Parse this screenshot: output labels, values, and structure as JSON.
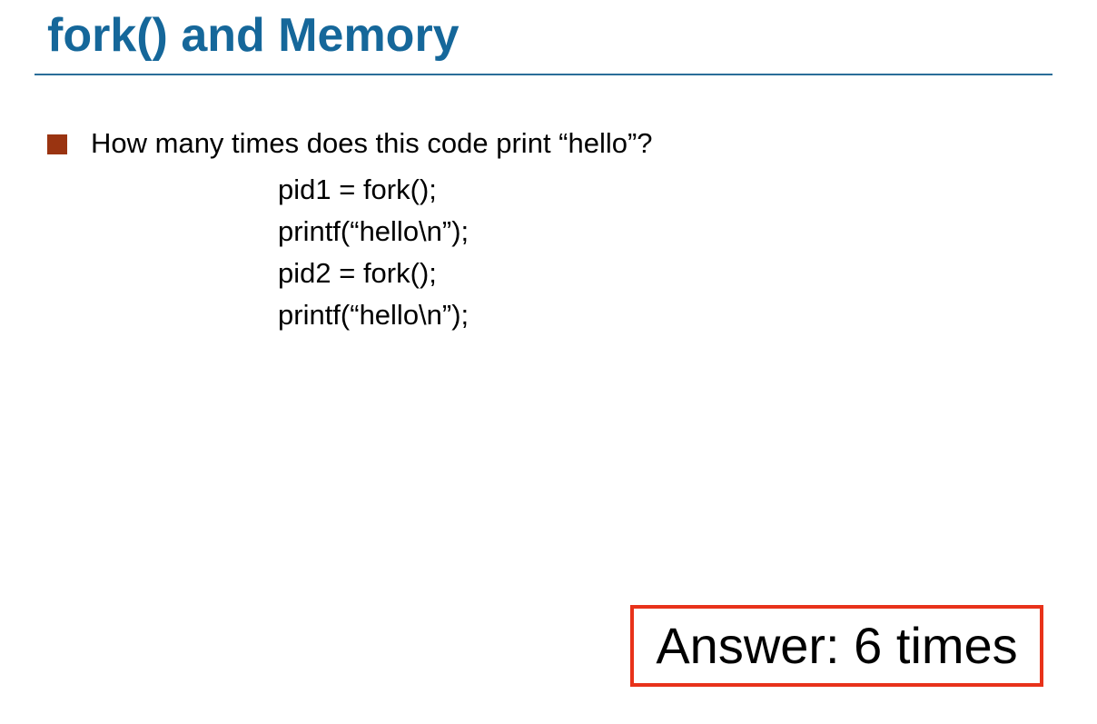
{
  "slide": {
    "title": "fork() and Memory",
    "bullet": "How many times does this code print “hello”?",
    "code_lines": [
      "pid1 = fork();",
      "printf(“hello\\n”);",
      "pid2 = fork();",
      "printf(“hello\\n”);"
    ],
    "answer": "Answer: 6 times"
  },
  "colors": {
    "title": "#15679a",
    "rule": "#2a6d99",
    "bullet": "#9a3411",
    "answer_border": "#e8321a"
  }
}
